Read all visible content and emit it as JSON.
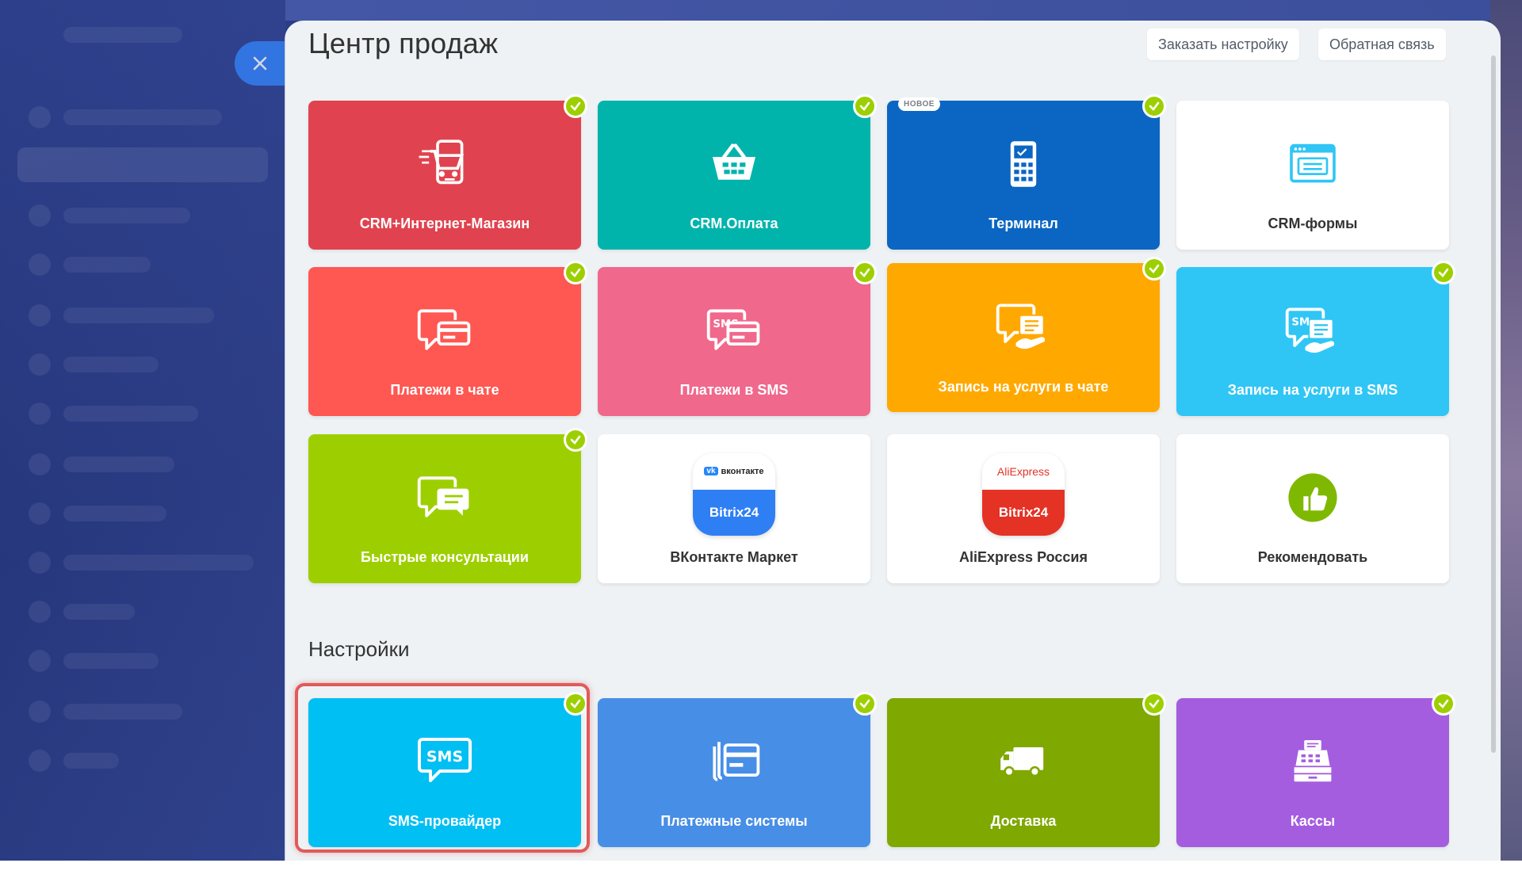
{
  "panel": {
    "title": "Центр продаж",
    "order_setup_label": "Заказать настройку",
    "feedback_label": "Обратная связь"
  },
  "sales_tiles": [
    {
      "label": "CRM+Интернет-Магазин",
      "color": "#e0434f",
      "icon": "online-store-cart-icon",
      "checked": true
    },
    {
      "label": "CRM.Оплата",
      "color": "#00b4ac",
      "icon": "basket-icon",
      "checked": true
    },
    {
      "label": "Терминал",
      "color": "#0b66c3",
      "icon": "payment-terminal-icon",
      "checked": true,
      "badge": "НОВОЕ"
    },
    {
      "label": "CRM-формы",
      "color": "#ffffff",
      "icon": "web-form-icon",
      "checked": false
    },
    {
      "label": "Платежи в чате",
      "color": "#ff5752",
      "icon": "chat-payment-icon",
      "checked": true
    },
    {
      "label": "Платежи в SMS",
      "color": "#f0688c",
      "icon": "sms-payment-icon",
      "checked": true
    },
    {
      "label": "Запись на услуги в чате",
      "color": "#ffa900",
      "icon": "chat-booking-icon",
      "checked": true
    },
    {
      "label": "Запись на услуги в SMS",
      "color": "#2fc6f6",
      "icon": "sms-booking-icon",
      "checked": true
    },
    {
      "label": "Быстрые консультации",
      "color": "#9dcf00",
      "icon": "consultation-chat-icon",
      "checked": true
    },
    {
      "label": "ВКонтакте Маркет",
      "color": "#ffffff",
      "icon": "vk-market-logo",
      "checked": false,
      "logo_top": "вконтакте",
      "logo_bottom": "Bitrix24"
    },
    {
      "label": "AliExpress Россия",
      "color": "#ffffff",
      "icon": "aliexpress-logo",
      "checked": false,
      "logo_top": "AliExpress",
      "logo_bottom": "Bitrix24"
    },
    {
      "label": "Рекомендовать",
      "color": "#ffffff",
      "icon": "thumbs-up-icon",
      "checked": false
    }
  ],
  "settings": {
    "title": "Настройки",
    "tiles": [
      {
        "label": "SMS-провайдер",
        "color": "#00bff3",
        "icon": "sms-provider-icon",
        "checked": true,
        "icon_text": "SMS"
      },
      {
        "label": "Платежные системы",
        "color": "#478ee6",
        "icon": "payment-systems-icon",
        "checked": true
      },
      {
        "label": "Доставка",
        "color": "#7fa800",
        "icon": "delivery-truck-icon",
        "checked": true
      },
      {
        "label": "Кассы",
        "color": "#a55ddf",
        "icon": "cash-register-icon",
        "checked": true
      }
    ]
  },
  "colors": {
    "accent": "#2f7ff4",
    "check": "#9dcf00",
    "panel_bg": "#eef2f4",
    "highlight": "#e05a5a"
  }
}
